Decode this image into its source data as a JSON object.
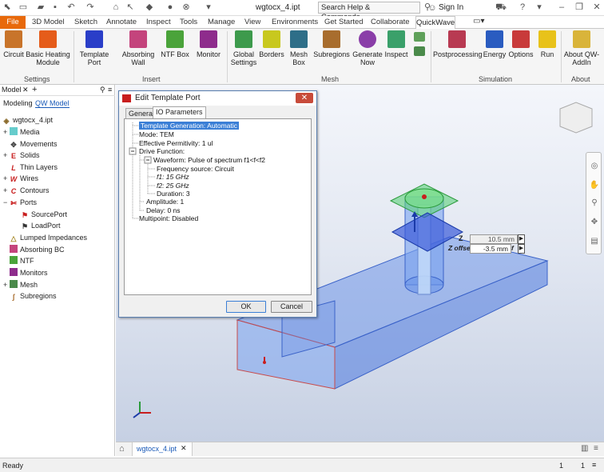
{
  "titlebar": {
    "document_title": "wgtocx_4.ipt",
    "search_placeholder": "Search Help & Commands...",
    "sign_in": "Sign In"
  },
  "menu": [
    "File",
    "3D Model",
    "Sketch",
    "Annotate",
    "Inspect",
    "Tools",
    "Manage",
    "View",
    "Environments",
    "Get Started",
    "Collaborate",
    "QuickWave"
  ],
  "ribbon": {
    "settings": {
      "label": "Settings",
      "buttons": [
        "Circuit",
        "Basic Heating Module"
      ]
    },
    "insert": {
      "label": "Insert",
      "buttons": [
        "Template Port",
        "Absorbing Wall",
        "NTF Box",
        "Monitor"
      ]
    },
    "mesh": {
      "label": "Mesh",
      "buttons": [
        "Global Settings",
        "Borders",
        "Mesh Box",
        "Subregions",
        "Generate Now",
        "Inspect"
      ]
    },
    "simulation": {
      "label": "Simulation",
      "buttons": [
        "Postprocessing",
        "Energy",
        "Options",
        "Run"
      ]
    },
    "about": {
      "label": "About",
      "buttons": [
        "About QW-AddIn"
      ]
    }
  },
  "leftpanel": {
    "tab_model": "Model",
    "tab_modeling": "Modeling",
    "tab_qwmodel": "QW Model",
    "root": "wgtocx_4.ipt",
    "items": [
      "Media",
      "Movements",
      "Solids",
      "Thin Layers",
      "Wires",
      "Contours",
      "Ports",
      "SourcePort",
      "LoadPort",
      "Lumped Impedances",
      "Absorbing BC",
      "NTF",
      "Monitors",
      "Mesh",
      "Subregions"
    ]
  },
  "dialog": {
    "title": "Edit Template Port",
    "tabs": [
      "General",
      "IO Parameters"
    ],
    "tree": {
      "generation": "Template Generation: Automatic",
      "mode": "Mode: TEM",
      "permittivity": "Effective Permitivity: 1 ul",
      "drive": "Drive Function:",
      "waveform": "Waveform: Pulse of spectrum f1<f<f2",
      "freq_source": "Frequency source: Circuit",
      "f1": "f1: 15 GHz",
      "f2": "f2: 25 GHz",
      "duration": "Duration: 3",
      "amplitude": "Amplitude: 1",
      "delay": "Delay: 0 ns",
      "multipoint": "Multipoint: Disabled"
    },
    "ok": "OK",
    "cancel": "Cancel"
  },
  "viewport": {
    "z_label": "Z",
    "z_value": "10.5 mm",
    "zoffset_label": "Z offse",
    "zoffset_value": "-3.5 mm",
    "f_label": "f"
  },
  "doctab": "wgtocx_4.ipt",
  "status": {
    "text": "Ready",
    "count1": "1",
    "count2": "1"
  }
}
